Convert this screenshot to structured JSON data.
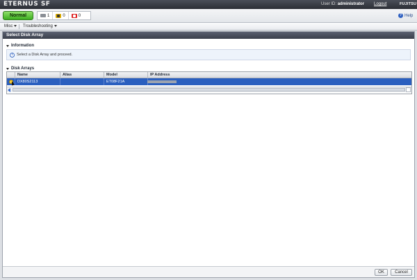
{
  "brand": {
    "title": "ETERNUS SF",
    "vendor": "FUJITSU"
  },
  "user": {
    "label": "User ID",
    "name": "administrator",
    "logout": "Logout"
  },
  "status": {
    "overall": "Normal",
    "counts": [
      {
        "icon": "info-icon",
        "value": "1"
      },
      {
        "icon": "warning-icon",
        "value": "0"
      },
      {
        "icon": "error-icon",
        "value": "0"
      }
    ]
  },
  "help": "Help",
  "menus": [
    {
      "label": "Misc"
    },
    {
      "label": "Troubleshooting"
    }
  ],
  "page": {
    "title": "Select Disk Array"
  },
  "information": {
    "heading": "Information",
    "message": "Select a Disk Array and proceed."
  },
  "disk_arrays": {
    "heading": "Disk Arrays",
    "columns": [
      "Name",
      "Alias",
      "Model",
      "IP Address"
    ],
    "rows": [
      {
        "name": "DX80S2113",
        "alias": "",
        "model": "ET08F21A",
        "ip": ""
      }
    ]
  },
  "footer": {
    "ok": "OK",
    "cancel": "Cancel"
  }
}
